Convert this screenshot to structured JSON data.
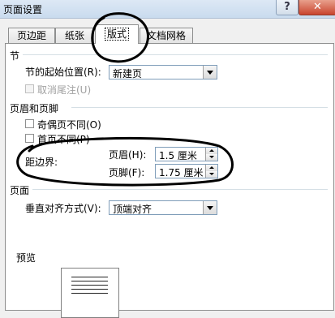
{
  "window": {
    "title": "页面设置",
    "help_label": "?",
    "close_label": "✕"
  },
  "tabs": [
    {
      "label": "页边距"
    },
    {
      "label": "纸张"
    },
    {
      "label": "版式",
      "active": true
    },
    {
      "label": "文档网格"
    }
  ],
  "section_section": {
    "heading": "节",
    "start_label": "节的起始位置(R):",
    "start_value": "新建页",
    "suppress_endnotes_label": "取消尾注(U)"
  },
  "section_headers": {
    "heading": "页眉和页脚",
    "odd_even_label": "奇偶页不同(O)",
    "first_page_label": "首页不同(P)",
    "distance_label": "距边界:",
    "header_label": "页眉(H):",
    "header_value": "1.5 厘米",
    "footer_label": "页脚(F):",
    "footer_value": "1.75 厘米"
  },
  "section_page": {
    "heading": "页面",
    "valign_label": "垂直对齐方式(V):",
    "valign_value": "顶端对齐"
  },
  "preview": {
    "heading": "预览"
  },
  "annotation_color": "#000000"
}
